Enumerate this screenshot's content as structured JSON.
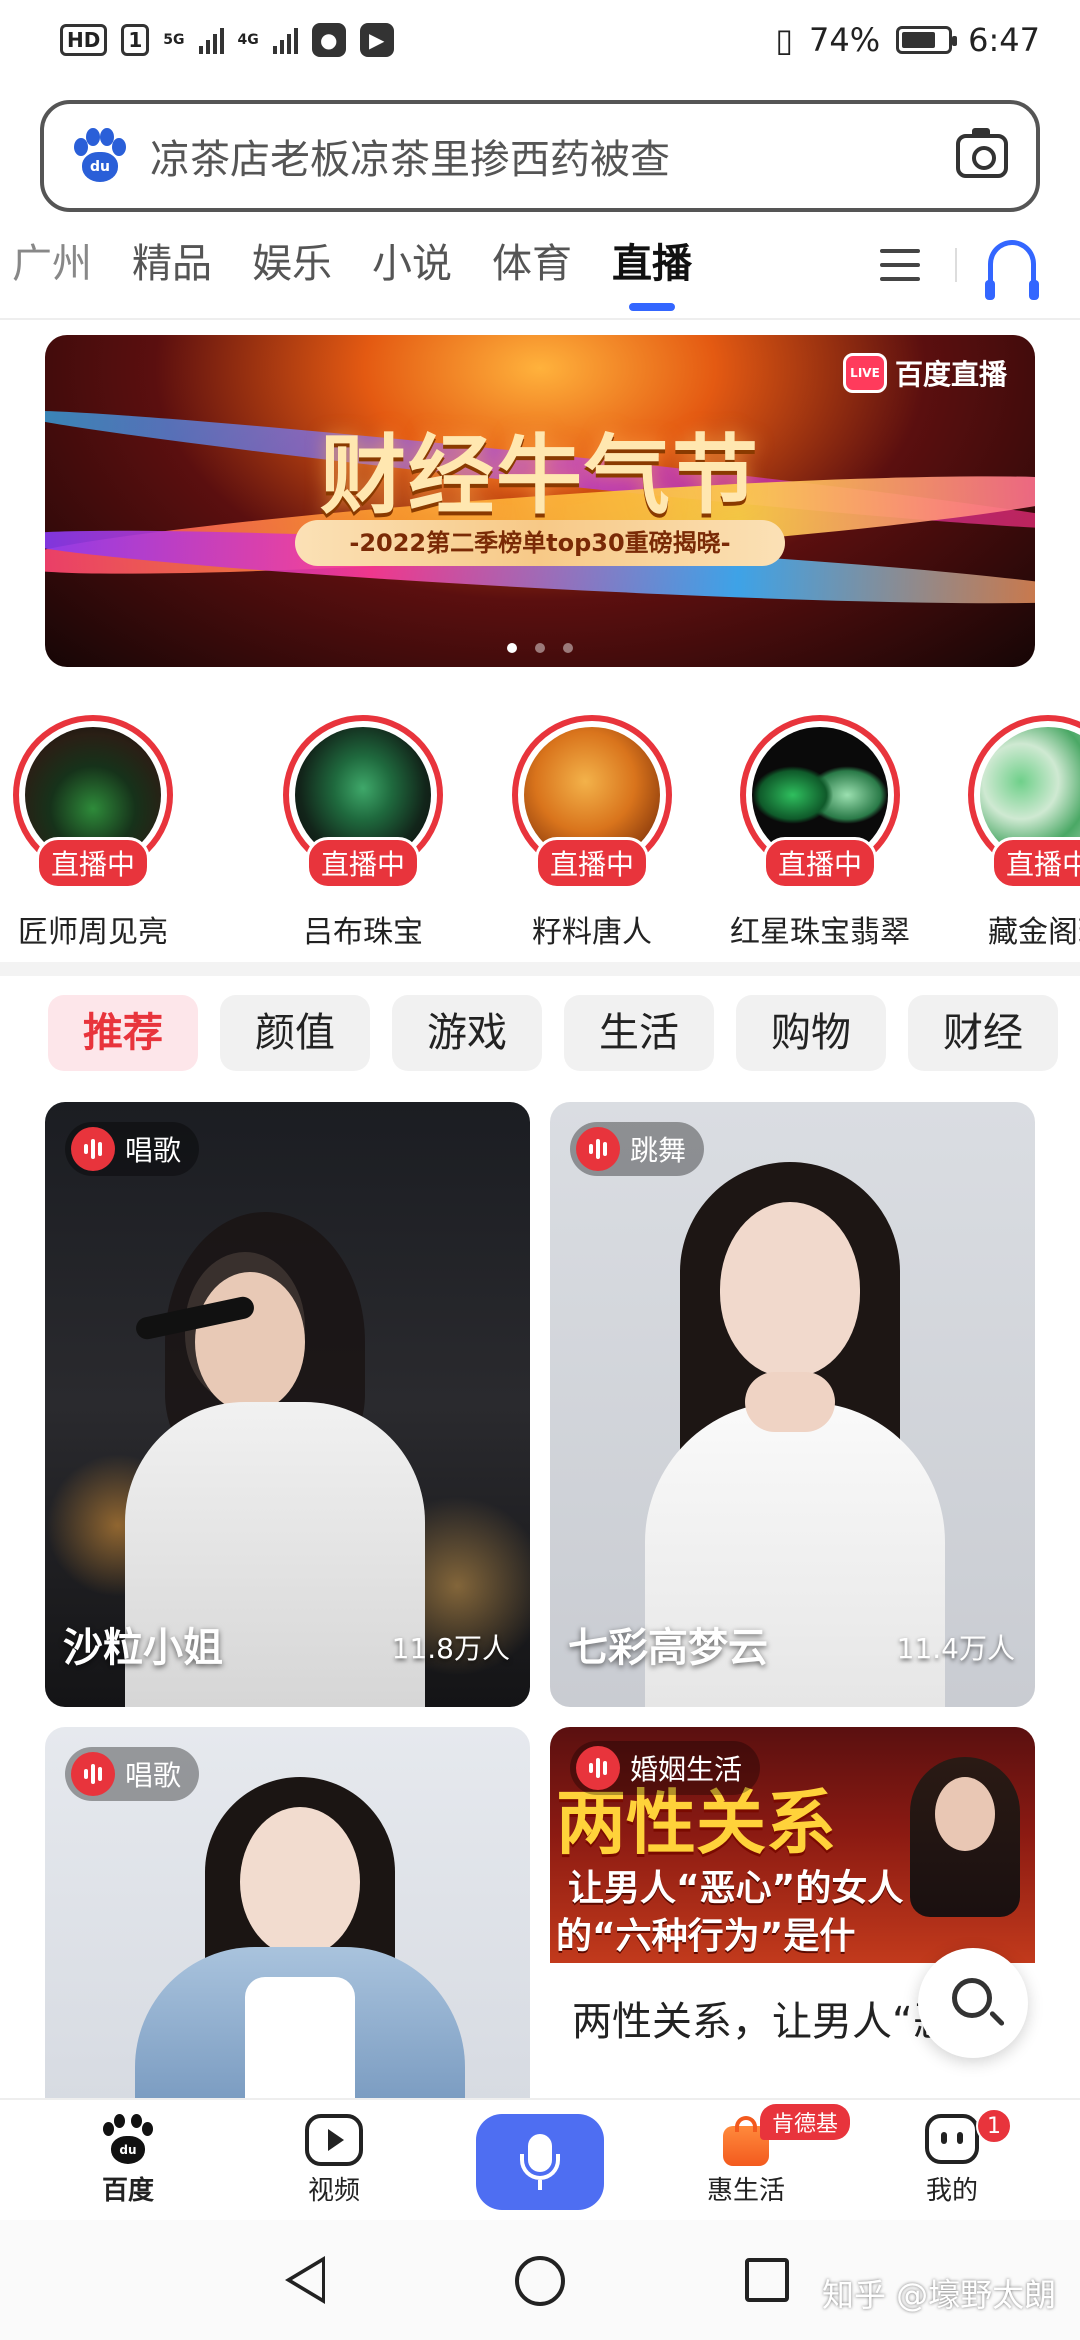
{
  "status_bar": {
    "hd_label": "HD",
    "sim_label": "1",
    "net1_label": "5G",
    "net2_label": "4G",
    "battery_text": "74%",
    "battery_level": 0.74,
    "time": "6:47"
  },
  "search": {
    "text": "凉茶店老板凉茶里掺西药被查",
    "logo_text": "du"
  },
  "tabs": [
    "广州",
    "精品",
    "娱乐",
    "小说",
    "体育",
    "直播"
  ],
  "active_tab": "直播",
  "banner": {
    "title": "财经牛气节",
    "subtitle": "-2022第二季榜单top30重磅揭晓-",
    "badge_icon_text": "LIVE",
    "badge_text": "百度直播",
    "page_count": 3,
    "active_page": 1
  },
  "streamers": [
    {
      "name": "匠师周见亮",
      "live_label": "直播中"
    },
    {
      "name": "吕布珠宝",
      "live_label": "直播中"
    },
    {
      "name": "籽料唐人",
      "live_label": "直播中"
    },
    {
      "name": "红星珠宝翡翠",
      "live_label": "直播中"
    },
    {
      "name": "藏金阁珠",
      "live_label": "直播中"
    }
  ],
  "categories": [
    "推荐",
    "颜值",
    "游戏",
    "生活",
    "购物",
    "财经"
  ],
  "active_category": "推荐",
  "feed": [
    {
      "tag": "唱歌",
      "name": "沙粒小姐",
      "viewers": "11.8万人"
    },
    {
      "tag": "跳舞",
      "name": "七彩高梦云",
      "viewers": "11.4万人"
    },
    {
      "tag": "唱歌",
      "name": "",
      "viewers": ""
    },
    {
      "tag": "婚姻生活",
      "thumb_title": "两性关系",
      "thumb_line1": "让男人“恶心”的女人",
      "thumb_line2": "的“六种行为”是什",
      "caption": "两性关系，让男人“恶"
    }
  ],
  "bottom_nav": {
    "items": [
      {
        "label": "百度",
        "icon_text": "du"
      },
      {
        "label": "视频"
      },
      {
        "label": "惠生活"
      },
      {
        "label": "我的"
      }
    ],
    "promo_badge": "肯德基",
    "profile_badge": "1"
  },
  "watermark": "知乎 @壕野太朗",
  "colors": {
    "accent_blue": "#3366ff",
    "live_red": "#e8343c",
    "mic_blue": "#4e6ef2"
  }
}
